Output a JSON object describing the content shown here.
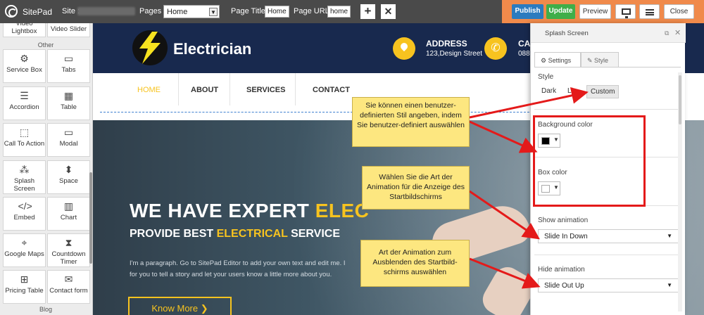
{
  "topbar": {
    "brand": "SitePad",
    "site_label": "Site :",
    "pages_label": "Pages :",
    "pages_value": "Home",
    "page_title_label": "Page Title:",
    "page_title_value": "Home",
    "page_url_label": "Page URL:",
    "page_url_value": "home",
    "add_icon": "+",
    "delete_icon": "✕",
    "publish": "Publish",
    "update": "Update",
    "preview": "Preview",
    "close": "Close"
  },
  "sidebar": {
    "top_tiles": [
      "Video Lightbox",
      "Video Slider"
    ],
    "section_other": "Other",
    "tiles": [
      {
        "label": "Service Box",
        "icon": "gear-icon",
        "glyph": "⚙"
      },
      {
        "label": "Tabs",
        "icon": "tabs-icon",
        "glyph": "▭"
      },
      {
        "label": "Accordion",
        "icon": "accordion-icon",
        "glyph": "☰"
      },
      {
        "label": "Table",
        "icon": "table-icon",
        "glyph": "▦"
      },
      {
        "label": "Call To Action",
        "icon": "pointer-icon",
        "glyph": "⬚"
      },
      {
        "label": "Modal",
        "icon": "modal-icon",
        "glyph": "▭"
      },
      {
        "label": "Splash Screen",
        "icon": "splash-icon",
        "glyph": "⁂"
      },
      {
        "label": "Space",
        "icon": "space-icon",
        "glyph": "⬍"
      },
      {
        "label": "Embed",
        "icon": "code-icon",
        "glyph": "</>"
      },
      {
        "label": "Chart",
        "icon": "chart-icon",
        "glyph": "▥"
      },
      {
        "label": "Google Maps",
        "icon": "map-icon",
        "glyph": "⌖"
      },
      {
        "label": "Countdown Timer",
        "icon": "hourglass-icon",
        "glyph": "⧗"
      },
      {
        "label": "Pricing Table",
        "icon": "pricing-icon",
        "glyph": "⊞"
      },
      {
        "label": "Contact form",
        "icon": "form-icon",
        "glyph": "✉"
      }
    ],
    "section_bottom": "Blog"
  },
  "site": {
    "brand": "Electrician",
    "address_title": "ADDRESS",
    "address_sub": "123,Design Street",
    "call_title": "CA",
    "call_sub": "088",
    "nav": [
      "HOME",
      "ABOUT",
      "SERVICES",
      "CONTACT"
    ],
    "hero_h1_a": "WE HAVE EXPERT ",
    "hero_h1_b": "ELEC",
    "hero_h2_a": "PROVIDE BEST ",
    "hero_h2_b": "ELECTRICAL",
    "hero_h2_c": " SERVICE",
    "hero_p1": "I'm a paragraph. Go to SitePad Editor to add your own text and edit me. I",
    "hero_p2": "for you to tell a story and let your users know a little more about you.",
    "cta": "Know More"
  },
  "panel": {
    "title": "Splash Screen",
    "tab_settings": "Settings",
    "tab_style": "Style",
    "style_label": "Style",
    "style_dark": "Dark",
    "style_light": "Li",
    "style_custom": "Custom",
    "bg_label": "Background color",
    "bg_color": "#000000",
    "box_label": "Box color",
    "box_color": "#ffffff",
    "show_label": "Show animation",
    "show_value": "Slide In Down",
    "hide_label": "Hide animation",
    "hide_value": "Slide Out Up"
  },
  "annotations": {
    "callout1": "Sie können einen benutzer-definierten Stil angeben, indem Sie benutzer-definiert auswählen",
    "callout2": "Wählen Sie die Art der Animation für die Anzeige des Startbildschirms",
    "callout3": "Art der Animation zum Ausblenden des Startbild-schirms auswählen"
  },
  "colors": {
    "accent_orange": "#f08a4b",
    "publish_blue": "#2b7bbf",
    "update_green": "#3fae49",
    "brand_yellow": "#f7c31f",
    "annotation_red": "#e41a1a",
    "callout_yellow": "#fde780"
  }
}
